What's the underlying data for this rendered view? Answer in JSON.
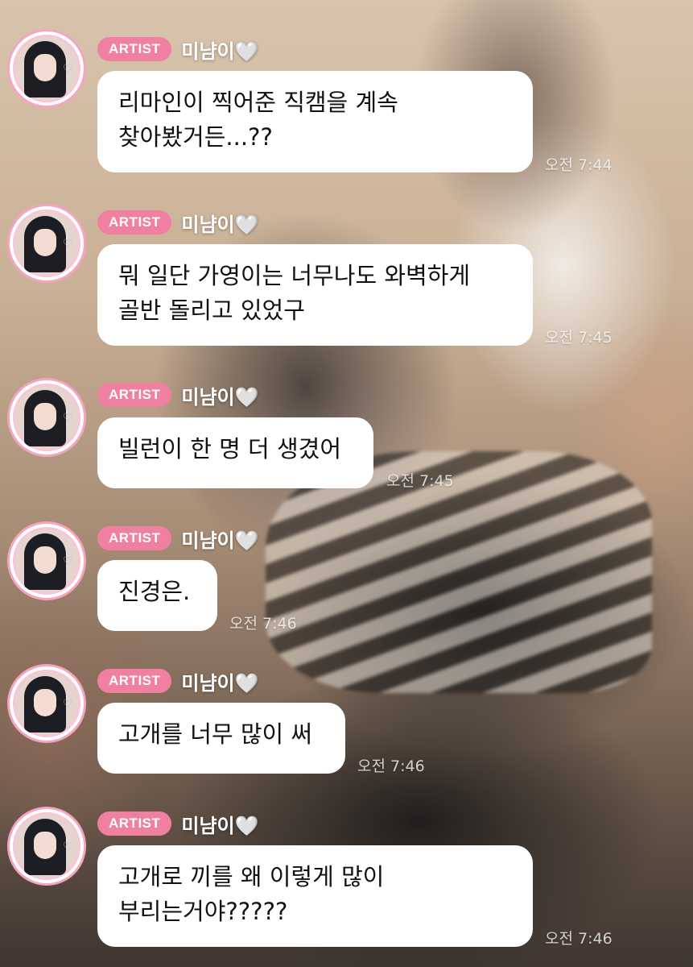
{
  "messages": [
    {
      "badge": "ARTIST",
      "sender": "미냠이🤍",
      "text": "리마인이 찍어준 직캠을 계속\n찾아봤거든...??",
      "time": "오전 7:44"
    },
    {
      "badge": "ARTIST",
      "sender": "미냠이🤍",
      "text": "뭐 일단 가영이는 너무나도 와벽하게\n골반 돌리고 있었구",
      "time": "오전 7:45"
    },
    {
      "badge": "ARTIST",
      "sender": "미냠이🤍",
      "text": "빌런이 한 명 더 생겼어",
      "time": "오전 7:45"
    },
    {
      "badge": "ARTIST",
      "sender": "미냠이🤍",
      "text": "진경은.",
      "time": "오전 7:46"
    },
    {
      "badge": "ARTIST",
      "sender": "미냠이🤍",
      "text": "고개를 너무 많이 써",
      "time": "오전 7:46"
    },
    {
      "badge": "ARTIST",
      "sender": "미냠이🤍",
      "text": "고개로 끼를 왜 이렇게 많이\n부리는거야?????",
      "time": "오전 7:46"
    }
  ],
  "colors": {
    "badge": "#f0809f",
    "avatar_ring": "#f6a5c0",
    "bubble": "#ffffff"
  },
  "icons": {
    "avatar": "profile-avatar",
    "heart": "white-heart-emoji"
  }
}
